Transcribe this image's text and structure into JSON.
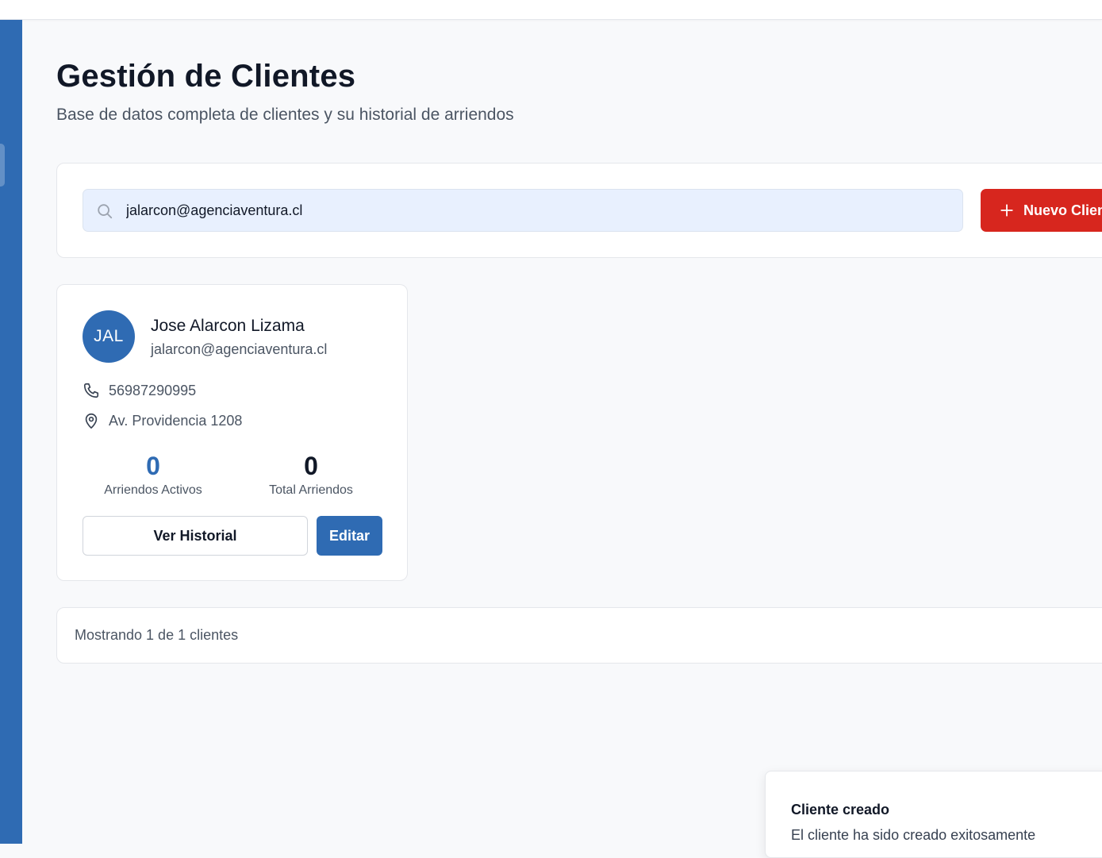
{
  "page": {
    "title": "Gestión de Clientes",
    "subtitle": "Base de datos completa de clientes y su historial de arriendos"
  },
  "search": {
    "value": "jalarcon@agenciaventura.cl",
    "icon": "search-icon"
  },
  "toolbar": {
    "new_client_label": "Nuevo Cliente",
    "new_client_icon": "plus-icon"
  },
  "client": {
    "initials": "JAL",
    "name": "Jose Alarcon Lizama",
    "email": "jalarcon@agenciaventura.cl",
    "phone": "56987290995",
    "address": "Av. Providencia 1208",
    "stats": {
      "active_value": "0",
      "active_label": "Arriendos Activos",
      "total_value": "0",
      "total_label": "Total Arriendos"
    },
    "history_button": "Ver Historial",
    "edit_button": "Editar"
  },
  "footer": {
    "summary": "Mostrando 1 de 1 clientes"
  },
  "toast": {
    "title": "Cliente creado",
    "message": "El cliente ha sido creado exitosamente"
  },
  "colors": {
    "brand_blue": "#2f6bb3",
    "danger_red": "#d7261e",
    "page_bg": "#f8f9fb"
  }
}
